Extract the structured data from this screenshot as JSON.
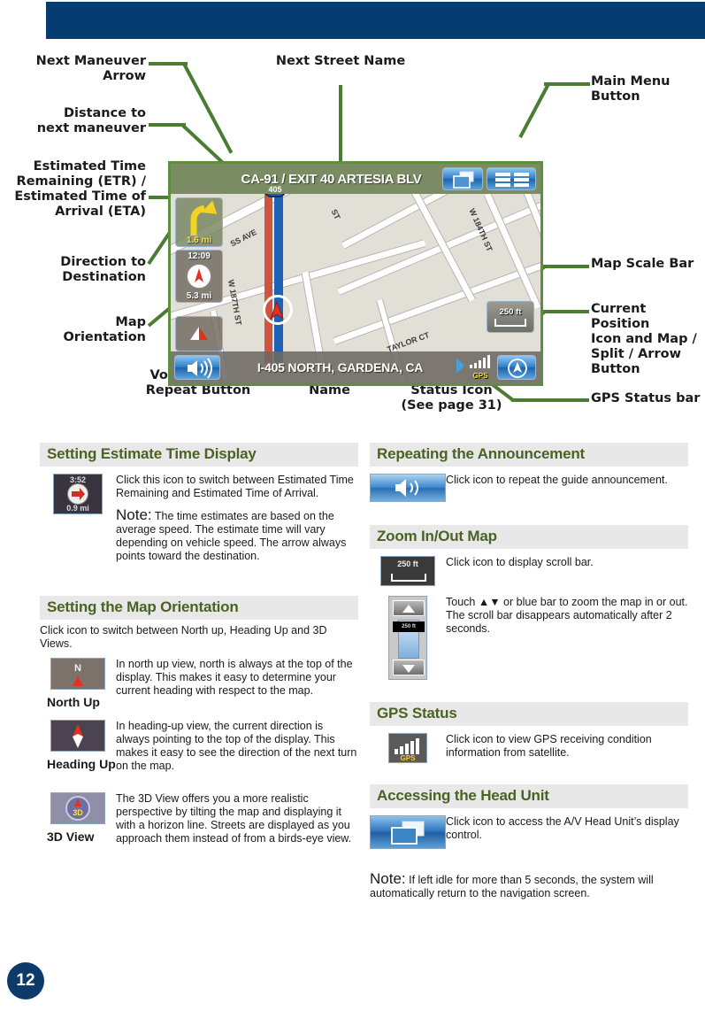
{
  "page": {
    "number": "12"
  },
  "diagram": {
    "callouts": {
      "next_maneuver_arrow": "Next Maneuver\nArrow",
      "distance_to_next": "Distance to\nnext maneuver",
      "etr_eta": "Estimated Time\nRemaining (ETR) /\nEstimated Time of\nArrival (ETA)",
      "direction_to_destination": "Direction to\nDestination",
      "map_orientation": "Map\nOrientation",
      "next_street_name": "Next Street Name",
      "main_menu_button": "Main Menu\nButton",
      "map_scale_bar": "Map Scale Bar",
      "current_position_button": "Current Position\nIcon and Map /\nSplit / Arrow\nButton",
      "gps_status_bar": "GPS Status bar",
      "voice_prompt_button": "Voice Prompt\nRepeat Button",
      "current_street_name": "Current Street\nName",
      "bluetooth_status_icon": "Bluetooth\nStatus Icon\n(See page 31)"
    }
  },
  "nav_screen": {
    "next_street": "CA-91 / EXIT 40 ARTESIA BLV",
    "maneuver_distance": "1.6 mi",
    "etr_time": "12:09",
    "etr_distance": "5.3 mi",
    "map_scale": "250 ft",
    "current_street": "I-405 NORTH, GARDENA, CA",
    "gps_label": "GPS",
    "shield_number": "405",
    "street_labels": [
      "W 184TH ST",
      "W 187TH ST",
      "TAYLOR CT",
      "ST",
      "SS AVE"
    ]
  },
  "sections": {
    "estimate_time": {
      "heading": "Setting Estimate Time Display",
      "thumb_top": "3:52",
      "thumb_bottom": "0.9 mi",
      "paragraph1": "Click this icon to switch between Estimated Time Remaining and Estimated Time of Arrival.",
      "note_label": "Note:",
      "note_text": " The time estimates are based on the average speed. The estimate time will vary depending on vehicle speed. The arrow always points toward the destination."
    },
    "map_orientation": {
      "heading": "Setting the Map Orientation",
      "intro": "Click icon to switch between North up, Heading Up and 3D Views.",
      "items": [
        {
          "caption": "North Up",
          "icon_text": "N",
          "text": "In north up view, north is always at the top of the display. This makes it easy to determine your current heading with respect to the map."
        },
        {
          "caption": "Heading Up",
          "icon_text": "",
          "text": "In heading-up view, the current direction is always pointing to the top of the display. This makes it easy to see the direction of the next turn on the map."
        },
        {
          "caption": "3D View",
          "icon_text": "3D",
          "text": "The 3D View offers you a more realistic perspective by tilting the map and displaying it with a horizon line. Streets are displayed as you approach them instead of from a birds-eye view."
        }
      ]
    },
    "repeating": {
      "heading": "Repeating the Announcement",
      "text": "Click icon to repeat the guide announcement."
    },
    "zoom_map": {
      "heading": "Zoom In/Out Map",
      "scale_label": "250 ft",
      "scroll_label": "250 ft",
      "text1": "Click icon to display scroll bar.",
      "text2": "Touch ▲▼ or blue bar to zoom the map in or out.\nThe scroll bar disappears automatically after 2 seconds."
    },
    "gps_status": {
      "heading": "GPS Status",
      "icon_label": "GPS",
      "text": "Click icon to view GPS receiving condition information from satellite."
    },
    "head_unit": {
      "heading": "Accessing the Head Unit",
      "text": "Click icon to access the A/V Head Unit’s display control.",
      "note_label": "Note:",
      "note_text": " If left idle for more than 5 seconds, the system will automatically return to the navigation screen."
    }
  },
  "colors": {
    "header_navy": "#053c72",
    "leader_green": "#4a7c32",
    "section_heading": "#4a6222",
    "section_band": "#e8e8e8",
    "nav_banner": "#7b8b63",
    "page_badge": "#0d3a6b"
  }
}
